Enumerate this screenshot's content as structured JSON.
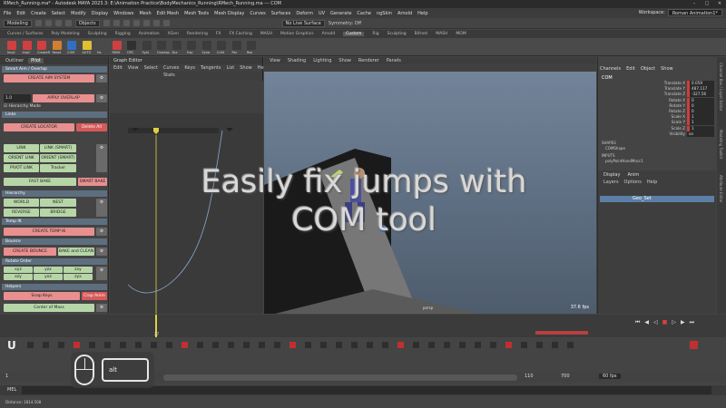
{
  "window": {
    "title": "RMech_Running.ma* - Autodesk MAYA 2023.3: E:\\Animation Practice\\BodyMechanics_Running\\RMech_Running.ma  ---  COM"
  },
  "menubar": {
    "items": [
      "File",
      "Edit",
      "Create",
      "Select",
      "Modify",
      "Display",
      "Windows",
      "Mesh",
      "Edit Mesh",
      "Mesh Tools",
      "Mesh Display",
      "Curves",
      "Surfaces",
      "Deform",
      "UV",
      "Generate",
      "Cache",
      "ngSkin",
      "Arnold",
      "Help"
    ],
    "workspace_label": "Workspace:",
    "workspace_value": "Roman Animation1*"
  },
  "statusline": {
    "mode": "Modeling",
    "objects": "Objects",
    "live_surface": "No Live Surface",
    "symmetry": "Symmetry: Off"
  },
  "shelf_tabs": [
    "Curves / Surfaces",
    "Poly Modeling",
    "Sculpting",
    "Rigging",
    "Animation",
    "XGen",
    "Rendering",
    "FX",
    "FX Caching",
    "MASH",
    "Motion Graphics",
    "Arnold",
    "Custom",
    "Rig",
    "Sculpting",
    "Bifrost",
    "MASH",
    "MOM"
  ],
  "shelf_active": "Custom",
  "shelf_buttons": [
    "ImpC",
    "ImpC",
    "CreateR",
    "Reset",
    "COM",
    "AUTO",
    "Hs",
    "RMSt",
    "OPC",
    "Syst",
    "Overlap",
    "Dur",
    "Exp",
    "Syna",
    "CnSt",
    "Par",
    "Res"
  ],
  "left_panel": {
    "tabs": [
      "Outliner",
      "Pilot"
    ],
    "sections": {
      "smart_aim": "Smart Aim / Overlap",
      "links": "Links",
      "hierarchy": "Hierarchy",
      "temp_ik": "Temp IK",
      "bounce": "Bounce",
      "rotate_order": "Rotate Order",
      "helpers": "Helpers"
    },
    "buttons": {
      "create_aim": "CREATE AIM SYSTEM",
      "overlap_value": "1.0",
      "apply_overlap": "APPLY OVERLAP",
      "hierarchy_mode": "Hierarchy Mode",
      "create_locator": "CREATE LOCATOR",
      "delete_all": "Delete All",
      "link": "LINK",
      "link_smart": "LINK (SMART)",
      "orient_link": "ORIENT LINK",
      "orient_smart": "ORIENT (SMART)",
      "pivot_link": "PIVOT LINK",
      "tracker": "Tracker",
      "fast_bake": "FAST BAKE",
      "smart_bake": "SMART BAKE",
      "world": "WORLD",
      "nest": "NEST",
      "reverse": "REVERSE",
      "bridge": "BRIDGE",
      "create_temp_ik": "CREATE TEMP IK",
      "create_bounce": "CREATE BOUNCE",
      "bake_and_clean": "BAKE and CLEAN",
      "ro": [
        "xyz",
        "yzx",
        "zxy",
        "xzy",
        "yxz",
        "zyx"
      ],
      "snap_keys": "Snap Keys",
      "crop_anim": "Crop Anim",
      "center_of_mass": "Center of Mass"
    }
  },
  "graph_editor": {
    "title": "Graph Editor",
    "menu": [
      "Edit",
      "View",
      "Select",
      "Curves",
      "Keys",
      "Tangents",
      "List",
      "Show",
      "Help"
    ],
    "stats": "Stats"
  },
  "viewport": {
    "menu": [
      "View",
      "Shading",
      "Lighting",
      "Show",
      "Renderer",
      "Panels"
    ],
    "camera": "persp",
    "fps": "37.6 fps"
  },
  "overlay_caption": {
    "line1": "Easily fix jumps with",
    "line2": "COM tool"
  },
  "channel_box": {
    "menu": [
      "Channels",
      "Edit",
      "Object",
      "Show"
    ],
    "object_name": "COM",
    "attributes": [
      {
        "name": "Translate X",
        "value": "0.059",
        "keyed": true
      },
      {
        "name": "Translate Y",
        "value": "487.117",
        "keyed": true
      },
      {
        "name": "Translate Z",
        "value": "-327.56",
        "keyed": true
      },
      {
        "name": "Rotate X",
        "value": "0",
        "keyed": true
      },
      {
        "name": "Rotate Y",
        "value": "0",
        "keyed": true
      },
      {
        "name": "Rotate Z",
        "value": "0",
        "keyed": true
      },
      {
        "name": "Scale X",
        "value": "1",
        "keyed": true
      },
      {
        "name": "Scale Y",
        "value": "1",
        "keyed": true
      },
      {
        "name": "Scale Z",
        "value": "1",
        "keyed": true
      },
      {
        "name": "Visibility",
        "value": "on",
        "keyed": false
      }
    ],
    "shapes_label": "SHAPES",
    "shape_name": "COMShape",
    "inputs_label": "INPUTS",
    "input_name": "polyPointHandMocc1",
    "layer_tabs": [
      "Display",
      "Anim"
    ],
    "layer_menu": [
      "Layers",
      "Options",
      "Help"
    ],
    "layer_name": "Geo_Set",
    "side_tabs": [
      "Channel Box / Layer Editor",
      "Modeling Toolkit",
      "Attribute Editor"
    ]
  },
  "timeline": {
    "current_frame": "27",
    "range_start": "1",
    "range_end": "110",
    "anim_end": "700",
    "fps_setting": "60 fps"
  },
  "command_line": {
    "label": "MEL"
  },
  "help_line": "Distance: 1814.508",
  "key_hint": {
    "key": "alt"
  },
  "colors": {
    "section_header": "#5d6f7f",
    "pink_button": "#e88f8f",
    "green_button": "#b7d6a7",
    "red_button": "#d65a5a",
    "key_tick": "#cf3d3d",
    "current_time": "#e0d040"
  }
}
